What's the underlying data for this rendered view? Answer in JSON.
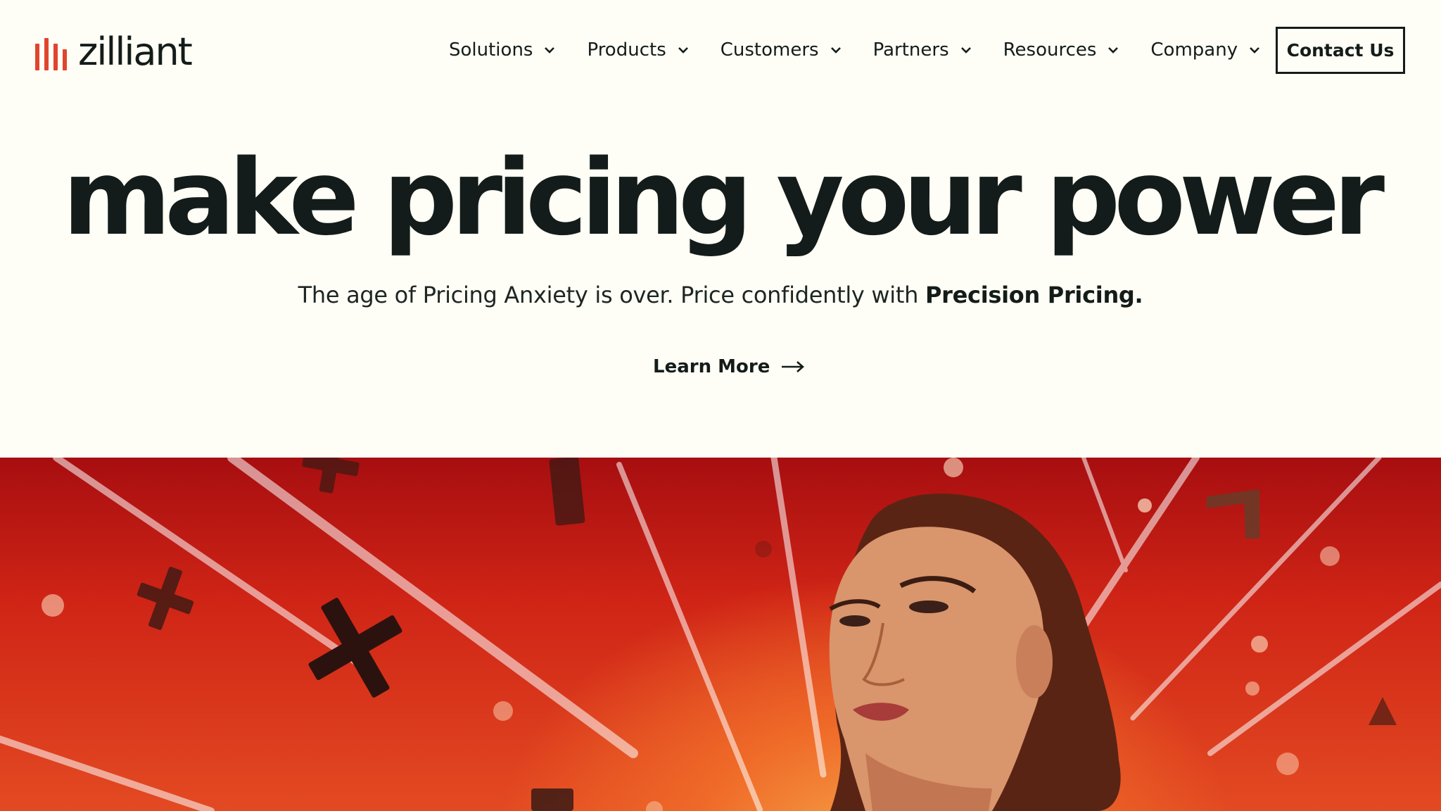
{
  "brand": {
    "name": "zilliant",
    "accent": "#e0452d"
  },
  "nav": {
    "items": [
      {
        "label": "Solutions"
      },
      {
        "label": "Products"
      },
      {
        "label": "Customers"
      },
      {
        "label": "Partners"
      },
      {
        "label": "Resources"
      },
      {
        "label": "Company"
      }
    ],
    "dropdown_icon": "chevron-down-icon",
    "contact_label": "Contact Us"
  },
  "hero": {
    "headline": "make pricing your power",
    "subline_text": "The age of Pricing Anxiety is over. Price confidently with ",
    "subline_bold": "Precision Pricing.",
    "cta_label": "Learn More",
    "cta_icon": "arrow-right-icon",
    "background": "#fefef6",
    "image_colors": [
      "#a70e10",
      "#e34a22",
      "#f5a246"
    ]
  }
}
